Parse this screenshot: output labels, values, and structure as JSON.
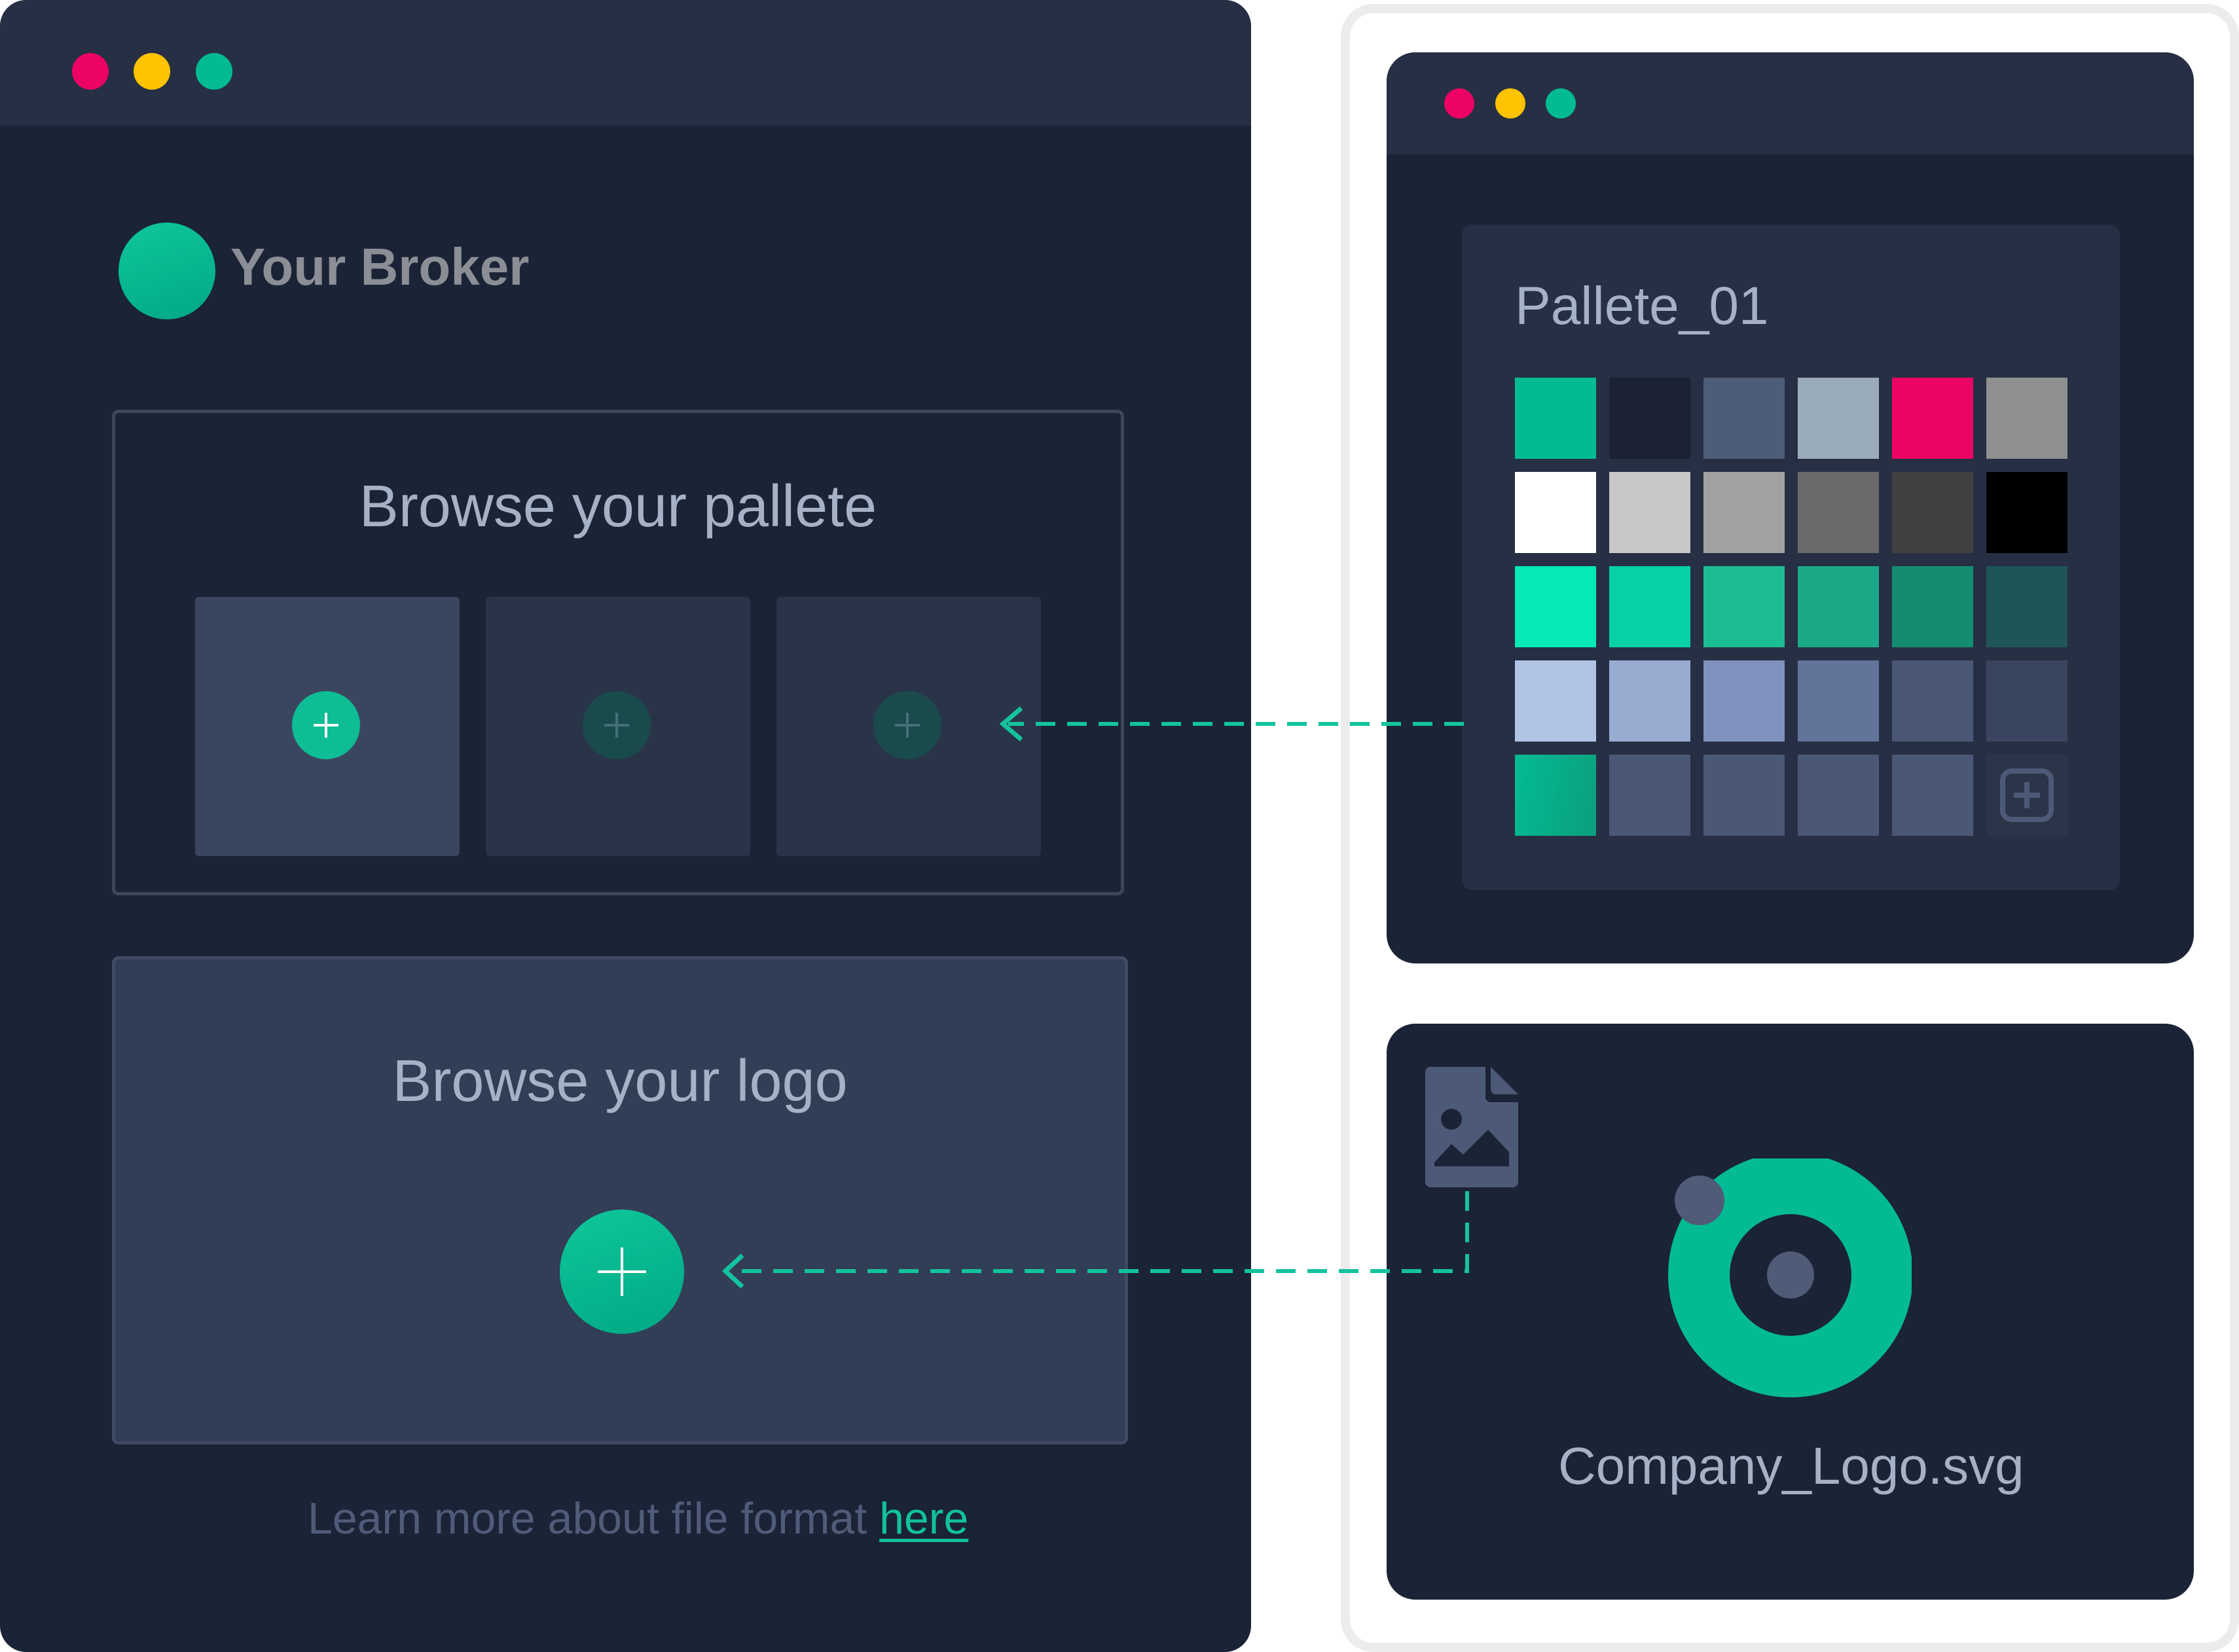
{
  "left_window": {
    "controls": [
      "close",
      "minimize",
      "maximize"
    ],
    "brand": {
      "name": "Your Broker",
      "logo_icon": "circle-logo"
    },
    "palette_section": {
      "title": "Browse your pallete",
      "slots": [
        {
          "state": "active",
          "icon": "plus-icon"
        },
        {
          "state": "inactive",
          "icon": "plus-icon"
        },
        {
          "state": "inactive",
          "icon": "plus-icon"
        }
      ]
    },
    "logo_section": {
      "title": "Browse your logo",
      "icon": "plus-icon"
    },
    "footer": {
      "text": "Learn more about file format ",
      "link": "here"
    }
  },
  "palette_window": {
    "controls": [
      "close",
      "minimize",
      "maximize"
    ],
    "palette_name": "Pallete_01",
    "swatches": [
      [
        "#03bb93",
        "#1b2234",
        "#4d5c78",
        "#9aabb9",
        "#ec0363",
        "#8f8f8f"
      ],
      [
        "#ffffff",
        "#c8c8c8",
        "#a2a2a2",
        "#6a6a6a",
        "#414141",
        "#000000"
      ],
      [
        "#04e9b6",
        "#06d1a5",
        "#1cbd94",
        "#1ba988",
        "#138c71",
        "#1f5559"
      ],
      [
        "#b1c4e4",
        "#98abd1",
        "#7f92bd",
        "#62749a",
        "#4a5876",
        "#39455f"
      ],
      [
        "gradient:#03bb93-#0b9f7c",
        "#4b5875",
        "#4b5875",
        "#4b5875",
        "#4b5875",
        "add"
      ]
    ],
    "add_swatch_icon": "add-square-icon"
  },
  "logo_window": {
    "file_icon": "image-file-icon",
    "filename": "Company_Logo.svg"
  },
  "colors": {
    "window_bg": "#1b2336",
    "titlebar_bg": "#262f43",
    "accent": "#03bb93",
    "dot_red": "#ec0363",
    "dot_yellow": "#ffc300",
    "dot_green": "#03bb93",
    "text_muted": "#a5b2c6"
  }
}
